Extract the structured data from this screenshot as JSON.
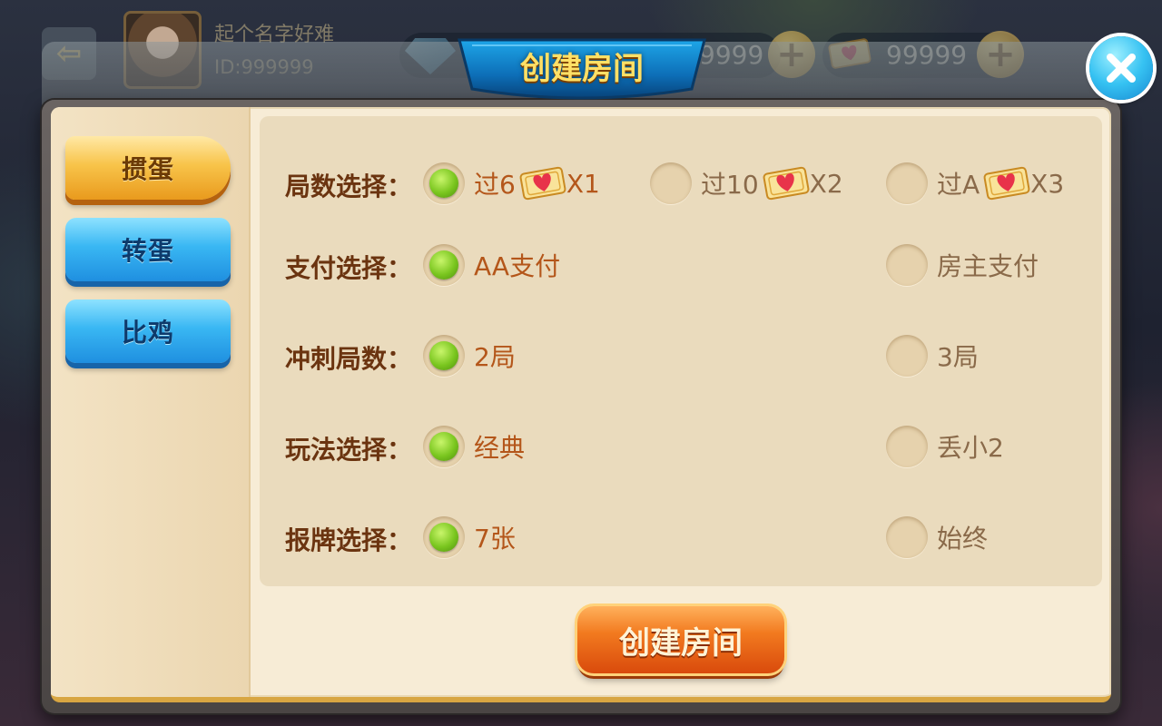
{
  "header": {
    "user_name": "起个名字好难",
    "user_id": "ID:999999",
    "diamonds": "9999",
    "tickets": "99999",
    "plus_symbol": "+"
  },
  "dialog": {
    "title": "创建房间",
    "close_icon": "close-icon"
  },
  "tabs": [
    {
      "label": "掼蛋",
      "active": true
    },
    {
      "label": "转蛋",
      "active": false
    },
    {
      "label": "比鸡",
      "active": false
    }
  ],
  "rows": [
    {
      "label": "局数选择：",
      "options": [
        {
          "text": "过6",
          "ticket": true,
          "multiplier": "X1",
          "selected": true
        },
        {
          "text": "过10",
          "ticket": true,
          "multiplier": "X2",
          "selected": false
        },
        {
          "text": "过A",
          "ticket": true,
          "multiplier": "X3",
          "selected": false
        }
      ]
    },
    {
      "label": "支付选择：",
      "options": [
        {
          "text": "AA支付",
          "selected": true
        },
        {
          "text": "房主支付",
          "selected": false
        }
      ]
    },
    {
      "label": "冲刺局数：",
      "options": [
        {
          "text": "2局",
          "selected": true
        },
        {
          "text": "3局",
          "selected": false
        }
      ]
    },
    {
      "label": "玩法选择：",
      "options": [
        {
          "text": "经典",
          "selected": true
        },
        {
          "text": "丢小2",
          "selected": false
        }
      ]
    },
    {
      "label": "报牌选择：",
      "options": [
        {
          "text": "7张",
          "selected": true
        },
        {
          "text": "始终",
          "selected": false
        }
      ]
    }
  ],
  "create_button": {
    "label": "创建房间"
  },
  "colors": {
    "accent_orange": "#f27a1f",
    "tab_active": "#f8c44a",
    "tab_inactive": "#39b7f3",
    "radio_selected": "#7ac61f",
    "label_brown": "#6b3410"
  }
}
